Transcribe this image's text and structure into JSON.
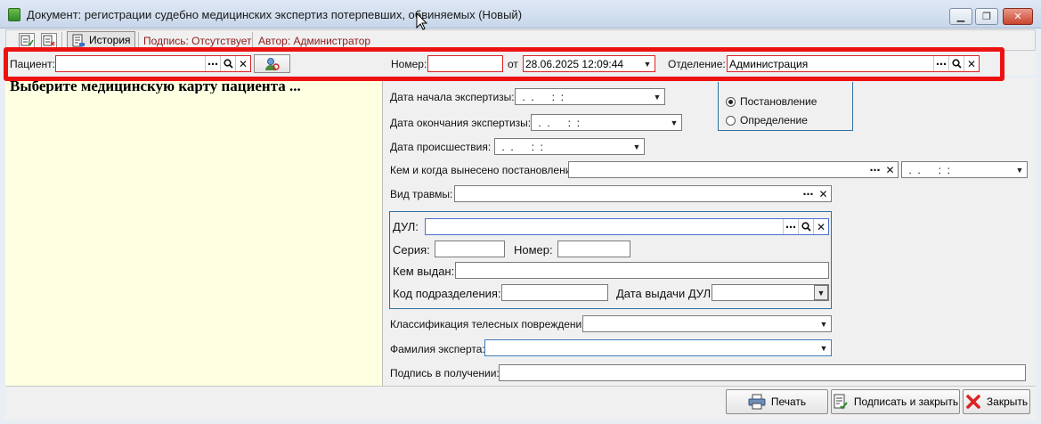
{
  "window": {
    "title": "Документ: регистрации судебно медицинских экспертиз потерпевших, обвиняемых (Новый)",
    "min": "▁",
    "max": "❐",
    "close": "✕"
  },
  "toolbar": {
    "history_label": "История",
    "signature_label": "Подпись: Отсутствует",
    "author_label": "Автор: Администратор"
  },
  "header": {
    "patient_label": "Пациент:",
    "patient_value": "",
    "number_label": "Номер:",
    "number_value": "",
    "from_label": "от",
    "date_value": "28.06.2025 12:09:44",
    "department_label": "Отделение:",
    "department_value": "Администрация"
  },
  "left": {
    "prompt": "Выберите медицинскую карту пациента ..."
  },
  "form": {
    "exam_start_label": "Дата начала экспертизы:",
    "exam_start_value": " .  .      :  :",
    "exam_end_label": "Дата окончания экспертизы:",
    "exam_end_value": " .  .      :  :",
    "incident_label": "Дата происшествия:",
    "incident_value": " .  .      :  :",
    "issued_by_label": "Кем и когда вынесено постановление:",
    "issued_date_value": " .  .      :  :",
    "injury_type_label": "Вид травмы:",
    "radio_1": "Постановление",
    "radio_2": "Определение",
    "dul_label": "ДУЛ:",
    "series_label": "Серия:",
    "doc_number_label": "Номер:",
    "issued_label": "Кем выдан:",
    "dept_code_label": "Код подразделения:",
    "issue_date_label": "Дата выдачи ДУЛ:",
    "classification_label": "Классификация телесных повреждений:",
    "expert_label": "Фамилия эксперта:",
    "receipt_label": "Подпись в получении:"
  },
  "buttons": {
    "print": "Печать",
    "sign_close": "Подписать и закрыть",
    "close": "Закрыть"
  },
  "icons": {
    "ellipsis": "⋯",
    "search": "🔍",
    "clear": "✕",
    "dropdown": "▼"
  }
}
